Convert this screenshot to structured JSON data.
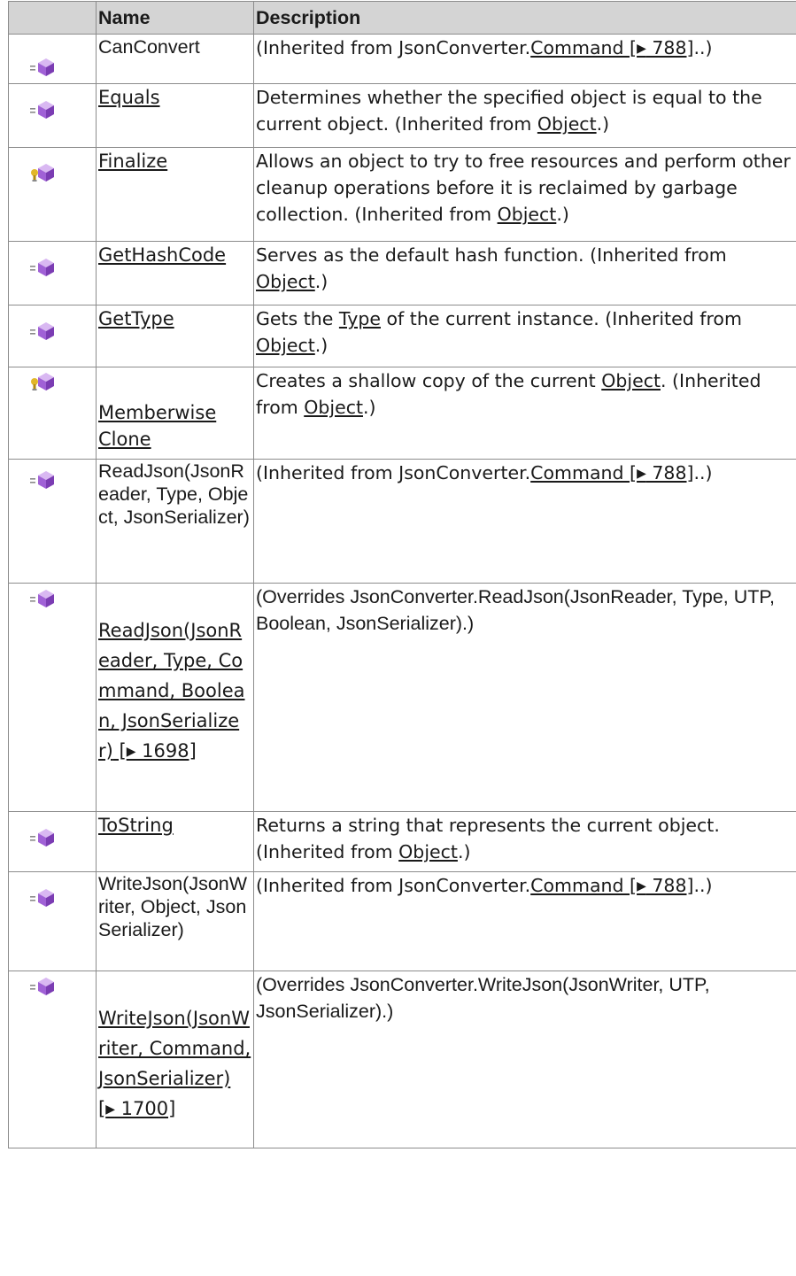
{
  "headers": {
    "icon": "",
    "name": "Name",
    "description": "Description"
  },
  "icons": {
    "public": "public-method-icon",
    "protected": "protected-method-icon"
  },
  "rows": [
    {
      "icon": "public",
      "name": "CanConvert",
      "name_link": false,
      "desc_pre": "(Inherited from JsonConverter.",
      "desc_link": "Command [",
      "desc_page": " 788]",
      "desc_post": "..)"
    },
    {
      "icon": "public",
      "name": "Equals",
      "name_link": true,
      "desc_pre": "Determines whether the specified object is equal to the current object. (Inherited from ",
      "desc_link": "Object",
      "desc_post": ".)"
    },
    {
      "icon": "protected",
      "name": "Finalize",
      "name_link": true,
      "desc_pre": "Allows an object to try to free resources and perform other cleanup operations before it is reclaimed by garbage collection. (Inherited from ",
      "desc_link": "Object",
      "desc_post": ".)"
    },
    {
      "icon": "public",
      "name": "GetHashCode",
      "name_link": true,
      "desc_pre": "Serves as the default hash function. (Inherited from ",
      "desc_link": "Object",
      "desc_post": ".)"
    },
    {
      "icon": "public",
      "name": "GetType",
      "name_link": true,
      "desc_pre": "Gets the ",
      "desc_link": "Type",
      "desc_mid": " of the current instance. (Inherited from ",
      "desc_link2": "Object",
      "desc_post": ".)"
    },
    {
      "icon": "protected",
      "name": "Memberwise Clone",
      "name_link": true,
      "desc_pre": "Creates a shallow copy of the current ",
      "desc_link": "Object",
      "desc_mid": ". (Inherited from ",
      "desc_link2": "Object",
      "desc_post": ".)"
    },
    {
      "icon": "public",
      "name": "ReadJson(JsonReader, Type, Object, JsonSerializer)",
      "name_link": false,
      "desc_pre": "(Inherited from JsonConverter.",
      "desc_link": "Command [",
      "desc_page": " 788]",
      "desc_post": "..)"
    },
    {
      "icon": "public",
      "name": "ReadJson(JsonReader, Type, Command, Boolean, JsonSerializer)",
      "name_link": true,
      "name_page": " 1698]",
      "desc_pre": "(Overrides JsonConverter.ReadJson(JsonReader, Type, UTP, Boolean, JsonSerializer).)"
    },
    {
      "icon": "public",
      "name": "ToString",
      "name_link": true,
      "desc_pre": "Returns a string that represents the current object. (Inherited from ",
      "desc_link": "Object",
      "desc_post": ".)"
    },
    {
      "icon": "public",
      "name": "WriteJson(JsonWriter, Object, JsonSerializer)",
      "name_link": false,
      "desc_pre": "(Inherited from JsonConverter.",
      "desc_link": "Command [",
      "desc_page": " 788]",
      "desc_post": "..)"
    },
    {
      "icon": "public",
      "name": "WriteJson(JsonWriter, Command, JsonSerializer)",
      "name_link": true,
      "name_page": " 1700]",
      "desc_pre": "(Overrides JsonConverter.WriteJson(JsonWriter, UTP, JsonSerializer).)"
    }
  ],
  "colors": {
    "header_bg": "#d4d4d4",
    "border": "#8c8c8c",
    "icon_purple": "#a061d6",
    "icon_yellow": "#e2b729"
  }
}
